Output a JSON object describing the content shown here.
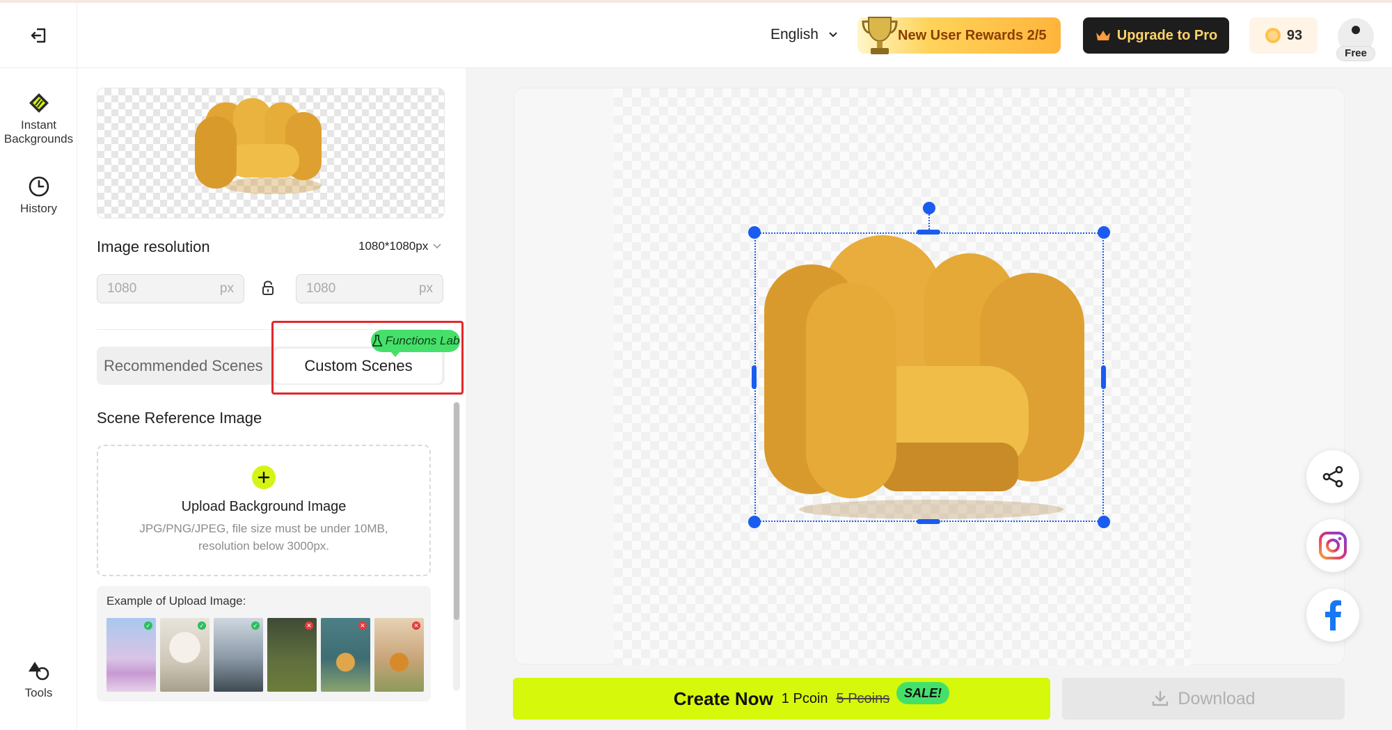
{
  "header": {
    "language": "English",
    "rewards_label": "New User Rewards 2/5",
    "upgrade_label": "Upgrade to Pro",
    "coins": "93",
    "plan_badge": "Free"
  },
  "rail": {
    "items": [
      {
        "label": "Instant Backgrounds",
        "icon": "instant-backgrounds-icon"
      },
      {
        "label": "History",
        "icon": "clock-icon"
      },
      {
        "label": "Tools",
        "icon": "shapes-icon"
      }
    ]
  },
  "panel": {
    "resolution_title": "Image resolution",
    "resolution_value": "1080*1080px",
    "width_placeholder": "1080",
    "height_placeholder": "1080",
    "unit": "px",
    "tabs": [
      {
        "label": "Recommended Scenes",
        "active": false
      },
      {
        "label": "Custom Scenes",
        "active": true
      }
    ],
    "lab_badge": "Functions Lab",
    "scene_ref_title": "Scene Reference Image",
    "upload_title": "Upload Background Image",
    "upload_hint": "JPG/PNG/JPEG, file size must be under 10MB, resolution below 3000px.",
    "examples_label": "Example of Upload Image:"
  },
  "actions": {
    "create_label": "Create Now",
    "price": "1 Pcoin",
    "old_price": "5 Pcoins",
    "sale_badge": "SALE!",
    "download_label": "Download"
  },
  "colors": {
    "accent_lime": "#d6f80a",
    "selection_blue": "#1a5cf0",
    "highlight_red": "#e3262a",
    "lab_green": "#45e06a"
  }
}
